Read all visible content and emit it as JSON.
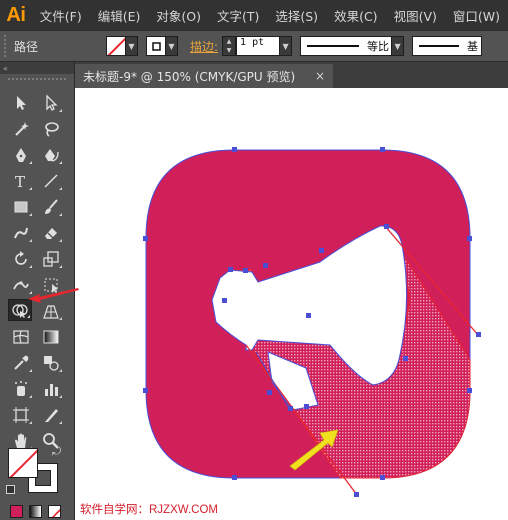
{
  "app": {
    "logo": "Ai"
  },
  "menu": [
    "文件(F)",
    "编辑(E)",
    "对象(O)",
    "文字(T)",
    "选择(S)",
    "效果(C)",
    "视图(V)",
    "窗口(W)"
  ],
  "control_bar": {
    "selection_label": "路径",
    "stroke_label": "描边:",
    "stroke_weight": "1 pt",
    "profile_label": "等比",
    "brush_label": "基"
  },
  "document_tab": {
    "title": "未标题-9* @ 150% (CMYK/GPU 预览)",
    "close": "×"
  },
  "toolbar": {
    "header": "«",
    "tools": [
      "selection-tool-icon",
      "direct-selection-tool-icon",
      "magic-wand-tool-icon",
      "lasso-tool-icon",
      "pen-tool-icon",
      "curvature-tool-icon",
      "type-tool-icon",
      "line-segment-tool-icon",
      "rectangle-tool-icon",
      "paintbrush-tool-icon",
      "blob-brush-tool-icon",
      "eraser-tool-icon",
      "rotate-tool-icon",
      "scale-tool-icon",
      "width-tool-icon",
      "free-transform-tool-icon",
      "shape-builder-tool-icon",
      "perspective-grid-tool-icon",
      "mesh-tool-icon",
      "gradient-tool-icon",
      "eyedropper-tool-icon",
      "blend-tool-icon",
      "symbol-sprayer-tool-icon",
      "column-graph-tool-icon",
      "artboard-tool-icon",
      "slice-tool-icon",
      "hand-tool-icon",
      "zoom-tool-icon"
    ],
    "active_tool": "shape-builder-tool-icon"
  },
  "colors": {
    "icon_fill": "#d11f5a",
    "path_outline": "#4b4fd6",
    "annotation_red": "#e8262f",
    "annotation_yellow": "#f0e020",
    "fill_color": "#d11f5a"
  },
  "watermark": "软件自学网：RJZXW.COM"
}
